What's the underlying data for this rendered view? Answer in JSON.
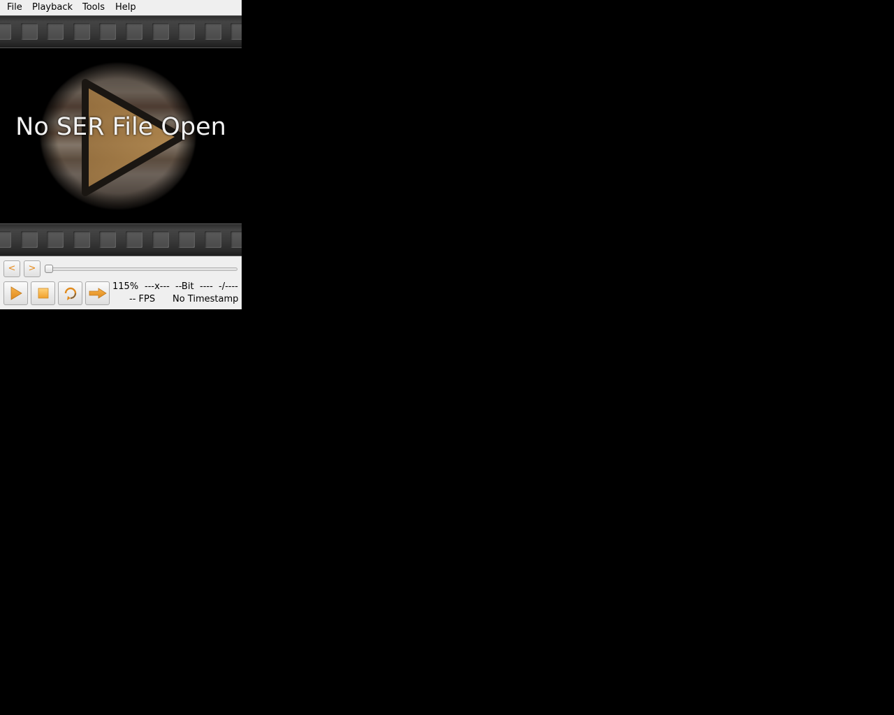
{
  "menu": {
    "file": "File",
    "playback": "Playback",
    "tools": "Tools",
    "help": "Help"
  },
  "video": {
    "status_text": "No SER File Open"
  },
  "scrub": {
    "prev_label": "<",
    "next_label": ">",
    "position": 0
  },
  "controls": {
    "play_icon": "play-icon",
    "stop_icon": "stop-icon",
    "repeat_icon": "repeat-icon",
    "forward_icon": "forward-arrow-icon"
  },
  "info": {
    "zoom": "115%",
    "dimensions": "---x---",
    "bit_depth": "--Bit",
    "color_mode": "----",
    "frame_counter": "-/----",
    "fps": "-- FPS",
    "timestamp": "No Timestamp"
  },
  "colors": {
    "accent": "#e68a1a",
    "background": "#000000",
    "panel": "#efefef"
  }
}
